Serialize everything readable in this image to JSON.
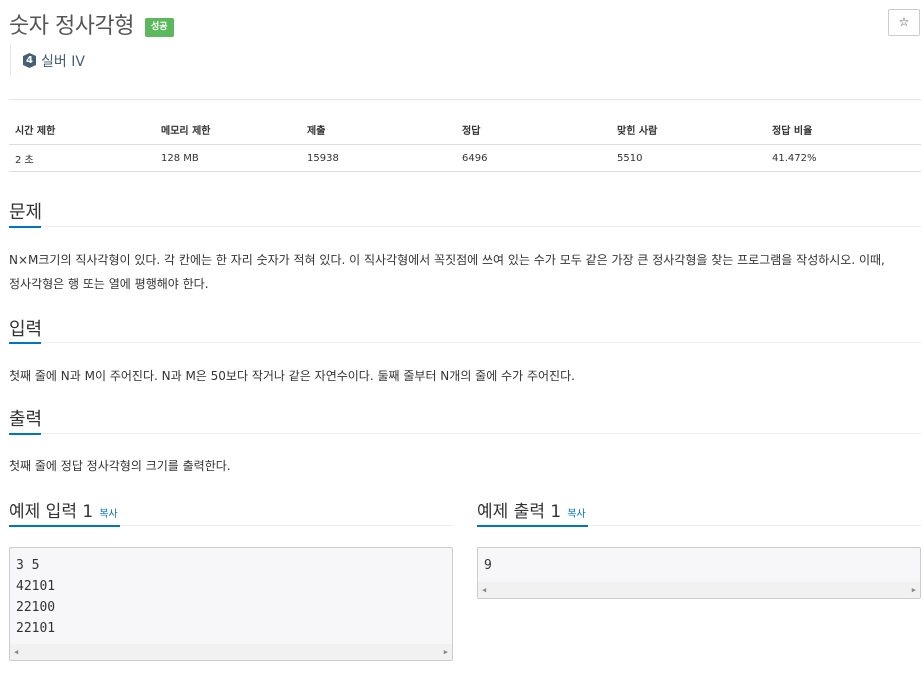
{
  "problem": {
    "title": "숫자 정사각형",
    "status_badge": "성공",
    "star_icon": "☆",
    "tier": {
      "number": "4",
      "label": "실버 IV",
      "color": "#435f7a"
    }
  },
  "stats": {
    "headers": [
      "시간 제한",
      "메모리 제한",
      "제출",
      "정답",
      "맞힌 사람",
      "정답 비율"
    ],
    "values": [
      "2 초",
      "128 MB",
      "15938",
      "6496",
      "5510",
      "41.472%"
    ]
  },
  "sections": {
    "description": {
      "title": "문제",
      "line1": "N×M크기의 직사각형이 있다. 각 칸에는 한 자리 숫자가 적혀 있다. 이 직사각형에서 꼭짓점에 쓰여 있는 수가 모두 같은 가장 큰 정사각형을 찾는 프로그램을 작성하시오. 이때,",
      "line2": "정사각형은 행 또는 열에 평행해야 한다."
    },
    "input": {
      "title": "입력",
      "text": "첫째 줄에 N과 M이 주어진다. N과 M은 50보다 작거나 같은 자연수이다. 둘째 줄부터 N개의 줄에 수가 주어진다."
    },
    "output": {
      "title": "출력",
      "text": "첫째 줄에 정답 정사각형의 크기를 출력한다."
    }
  },
  "examples": {
    "input": {
      "title": "예제 입력 1",
      "copy_label": "복사",
      "lines": [
        "3 5",
        "42101",
        "22100",
        "22101"
      ]
    },
    "output": {
      "title": "예제 출력 1",
      "copy_label": "복사",
      "lines": [
        "9"
      ]
    }
  },
  "colors": {
    "accent": "#0076c0",
    "success": "#5cb85c"
  }
}
